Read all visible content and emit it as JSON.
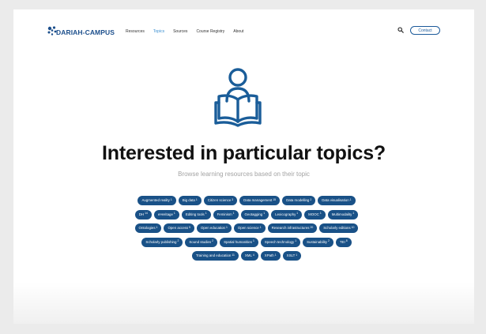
{
  "header": {
    "logo_text": "DARIAH-CAMPUS",
    "nav": [
      {
        "label": "Resources",
        "active": false
      },
      {
        "label": "Topics",
        "active": true
      },
      {
        "label": "Sources",
        "active": false
      },
      {
        "label": "Course Registry",
        "active": false
      },
      {
        "label": "About",
        "active": false
      }
    ],
    "search_icon": "search-icon",
    "contact_label": "Contact"
  },
  "hero": {
    "icon": "person-reading-book-icon",
    "title": "Interested in particular topics?",
    "subtitle": "Browse learning resources based on their topic"
  },
  "tags": [
    {
      "label": "Augmented reality",
      "count": "1"
    },
    {
      "label": "Big data",
      "count": "1"
    },
    {
      "label": "Citizen science",
      "count": "3"
    },
    {
      "label": "Data management",
      "count": "15"
    },
    {
      "label": "Data modelling",
      "count": "2"
    },
    {
      "label": "Data visualisation",
      "count": "1"
    },
    {
      "label": "DH",
      "count": "14"
    },
    {
      "label": "eHeritage",
      "count": "1"
    },
    {
      "label": "Editing tools",
      "count": "1"
    },
    {
      "label": "Feminism",
      "count": "1"
    },
    {
      "label": "Geotagging",
      "count": "1"
    },
    {
      "label": "Lexicography",
      "count": "1"
    },
    {
      "label": "MOOC",
      "count": "1"
    },
    {
      "label": "Multimodality",
      "count": "1"
    },
    {
      "label": "Ontologies",
      "count": "1"
    },
    {
      "label": "Open access",
      "count": "5"
    },
    {
      "label": "Open education",
      "count": "1"
    },
    {
      "label": "Open science",
      "count": "1"
    },
    {
      "label": "Research infrastructures",
      "count": "20"
    },
    {
      "label": "Scholarly editions",
      "count": "10"
    },
    {
      "label": "Scholarly publishing",
      "count": "2"
    },
    {
      "label": "Sound studies",
      "count": "2"
    },
    {
      "label": "Spatial humanities",
      "count": "1"
    },
    {
      "label": "Speech technology",
      "count": "1"
    },
    {
      "label": "Sustainability",
      "count": "2"
    },
    {
      "label": "TEI",
      "count": "8"
    },
    {
      "label": "Training and education",
      "count": "11"
    },
    {
      "label": "XML",
      "count": "4"
    },
    {
      "label": "XPath",
      "count": "1"
    },
    {
      "label": "XSLT",
      "count": "1"
    }
  ],
  "colors": {
    "brand": "#1c4f8c",
    "tag_background": "#195187",
    "active_nav": "#3a8fd0"
  }
}
